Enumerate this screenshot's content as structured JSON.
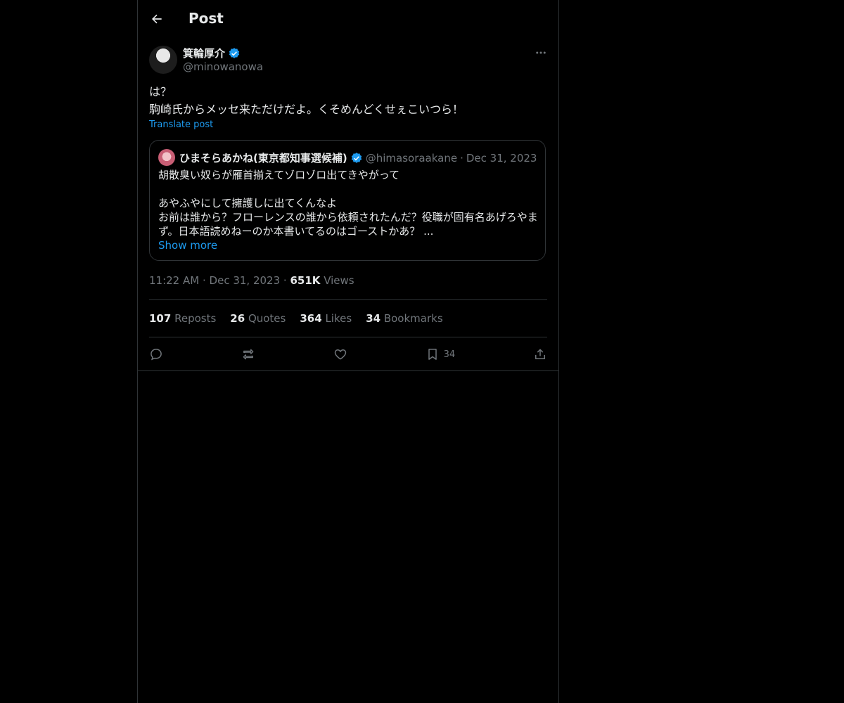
{
  "header": {
    "title": "Post"
  },
  "author": {
    "name": "箕輪厚介",
    "handle": "@minowanowa"
  },
  "post": {
    "line1": "は？",
    "line2": "駒崎氏からメッセ来ただけだよ。くそめんどくせぇこいつら！",
    "translate_label": "Translate post"
  },
  "quote": {
    "name": "ひまそらあかね(東京都知事選候補)",
    "handle": "@himasoraakane",
    "separator": "·",
    "date": "Dec 31, 2023",
    "line1": "胡散臭い奴らが雁首揃えてゾロゾロ出てきやがって",
    "line2": "あやふやにして擁護しに出てくんなよ",
    "line3": "お前は誰から？フローレンスの誰から依頼されたんだ？役職が固有名あげろやまず。日本語読めねーのか本書いてるのはゴーストかあ？ ...",
    "show_more": "Show more"
  },
  "meta": {
    "time": "11:22 AM",
    "date": "Dec 31, 2023",
    "separator": "·",
    "views_count": "651K",
    "views_label": "Views"
  },
  "stats": {
    "reposts_count": "107",
    "reposts_label": "Reposts",
    "quotes_count": "26",
    "quotes_label": "Quotes",
    "likes_count": "364",
    "likes_label": "Likes",
    "bookmarks_count": "34",
    "bookmarks_label": "Bookmarks"
  },
  "actions": {
    "bookmark_count": "34"
  },
  "colors": {
    "background": "#000000",
    "accent": "#1d9bf0",
    "verified": "#1d9bf0",
    "muted": "#71767b",
    "border": "#2f3336"
  }
}
